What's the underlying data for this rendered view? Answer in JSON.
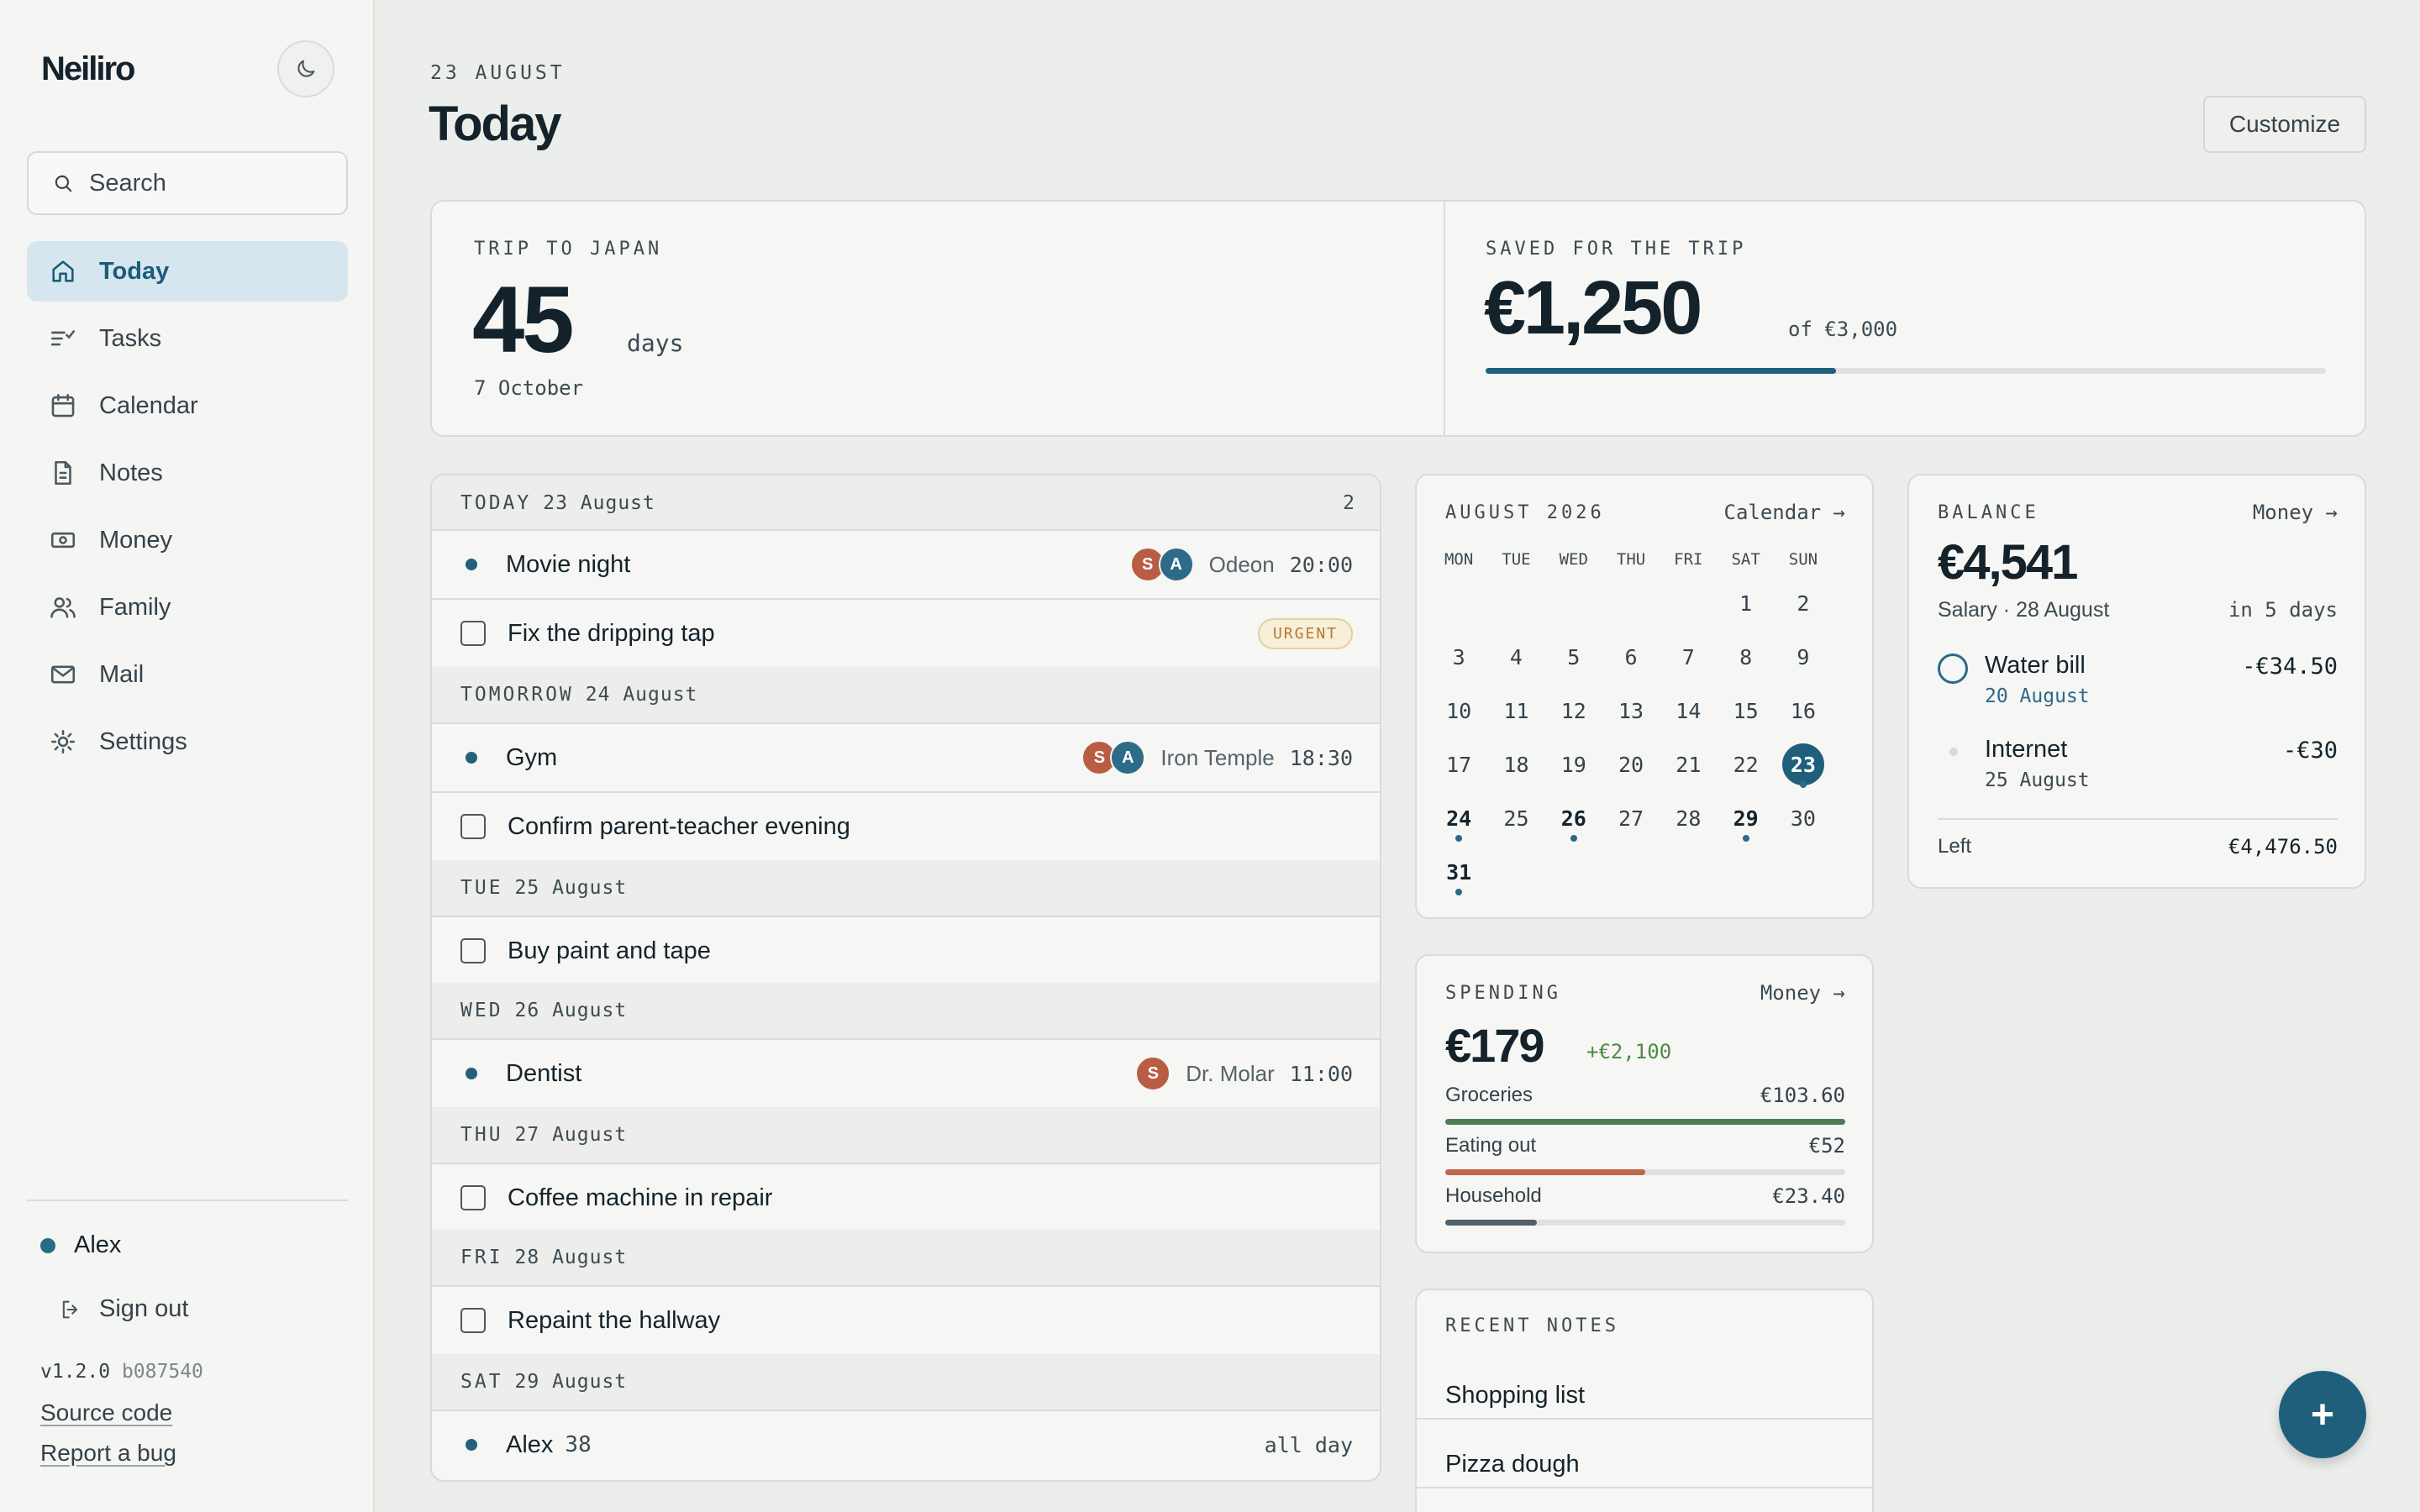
{
  "app": {
    "name": "Neiliro"
  },
  "sidebar": {
    "search_placeholder": "Search",
    "items": [
      {
        "label": "Today",
        "icon": "home-icon"
      },
      {
        "label": "Tasks",
        "icon": "tasks-icon"
      },
      {
        "label": "Calendar",
        "icon": "calendar-icon"
      },
      {
        "label": "Notes",
        "icon": "notes-icon"
      },
      {
        "label": "Money",
        "icon": "money-icon"
      },
      {
        "label": "Family",
        "icon": "family-icon"
      },
      {
        "label": "Mail",
        "icon": "mail-icon"
      },
      {
        "label": "Settings",
        "icon": "settings-icon"
      }
    ],
    "active": "Today",
    "user": "Alex",
    "sign_out": "Sign out",
    "version": "v1.2.0",
    "build": "b087540",
    "source_link": "Source code",
    "bug_link": "Report a bug"
  },
  "header": {
    "date": "23 AUGUST",
    "title": "Today",
    "customize": "Customize"
  },
  "trip": {
    "title": "TRIP TO JAPAN",
    "days": "45",
    "unit": "days",
    "date": "7 October"
  },
  "savings": {
    "title": "SAVED FOR THE TRIP",
    "amount": "€1,250",
    "of": "of €3,000",
    "progress": 0.4167
  },
  "agenda": {
    "today": {
      "label": "TODAY",
      "date": "23 August",
      "count": "2"
    },
    "rows": {
      "movie": {
        "title": "Movie night",
        "avatars": [
          "S",
          "A"
        ],
        "location": "Odeon",
        "time": "20:00"
      },
      "tap": {
        "title": "Fix the dripping tap",
        "badge": "URGENT"
      },
      "tomorrow": {
        "label": "TOMORROW",
        "date": "24 August"
      },
      "gym": {
        "title": "Gym",
        "avatars": [
          "S",
          "A"
        ],
        "location": "Iron Temple",
        "time": "18:30"
      },
      "parent": {
        "title": "Confirm parent-teacher evening"
      },
      "tue": {
        "label": "TUE",
        "date": "25 August"
      },
      "paint": {
        "title": "Buy paint and tape"
      },
      "wed": {
        "label": "WED",
        "date": "26 August"
      },
      "dentist": {
        "title": "Dentist",
        "avatars": [
          "S"
        ],
        "location": "Dr. Molar",
        "time": "11:00"
      },
      "thu": {
        "label": "THU",
        "date": "27 August"
      },
      "coffee": {
        "title": "Coffee machine in repair"
      },
      "fri": {
        "label": "FRI",
        "date": "28 August"
      },
      "hallway": {
        "title": "Repaint the hallway"
      },
      "sat": {
        "label": "SAT",
        "date": "29 August"
      },
      "alex": {
        "title": "Alex",
        "age": "38",
        "time": "all day"
      }
    }
  },
  "calendar": {
    "title": "AUGUST 2026",
    "link": "Calendar →",
    "dow": [
      "MON",
      "TUE",
      "WED",
      "THU",
      "FRI",
      "SAT",
      "SUN"
    ],
    "weeks": [
      [
        "",
        "",
        "",
        "",
        "",
        "1",
        "2"
      ],
      [
        "3",
        "4",
        "5",
        "6",
        "7",
        "8",
        "9"
      ],
      [
        "10",
        "11",
        "12",
        "13",
        "14",
        "15",
        "16"
      ],
      [
        "17",
        "18",
        "19",
        "20",
        "21",
        "22",
        "23"
      ],
      [
        "24",
        "25",
        "26",
        "27",
        "28",
        "29",
        "30"
      ],
      [
        "31",
        "",
        "",
        "",
        "",
        "",
        ""
      ]
    ],
    "today": "23",
    "event_days": [
      "23",
      "24",
      "26",
      "29",
      "31"
    ]
  },
  "balance": {
    "title": "BALANCE",
    "link": "Money →",
    "amount": "€4,541",
    "salary": "Salary · 28 August",
    "in_days": "in 5 days",
    "bills": [
      {
        "name": "Water bill",
        "date": "20 August",
        "amount": "-€34.50"
      },
      {
        "name": "Internet",
        "date": "25 August",
        "amount": "-€30"
      }
    ],
    "left_label": "Left",
    "left_value": "€4,476.50"
  },
  "spending": {
    "title": "SPENDING",
    "link": "Money →",
    "amount": "€179",
    "delta": "+€2,100",
    "categories": [
      {
        "label": "Groceries",
        "value": "€103.60",
        "fraction": 1.0,
        "color": "#4e7a55"
      },
      {
        "label": "Eating out",
        "value": "€52",
        "fraction": 0.5,
        "color": "#c0664a"
      },
      {
        "label": "Household",
        "value": "€23.40",
        "fraction": 0.23,
        "color": "#4f606a"
      }
    ]
  },
  "notes": {
    "title": "RECENT NOTES",
    "items": [
      "Shopping list",
      "Pizza dough"
    ]
  },
  "fab": {
    "label": "+"
  },
  "colors": {
    "accent": "#1f5f7b",
    "active_nav_bg": "#d6e6ee",
    "urgent": "#b8792d",
    "positive": "#4d8a47"
  }
}
